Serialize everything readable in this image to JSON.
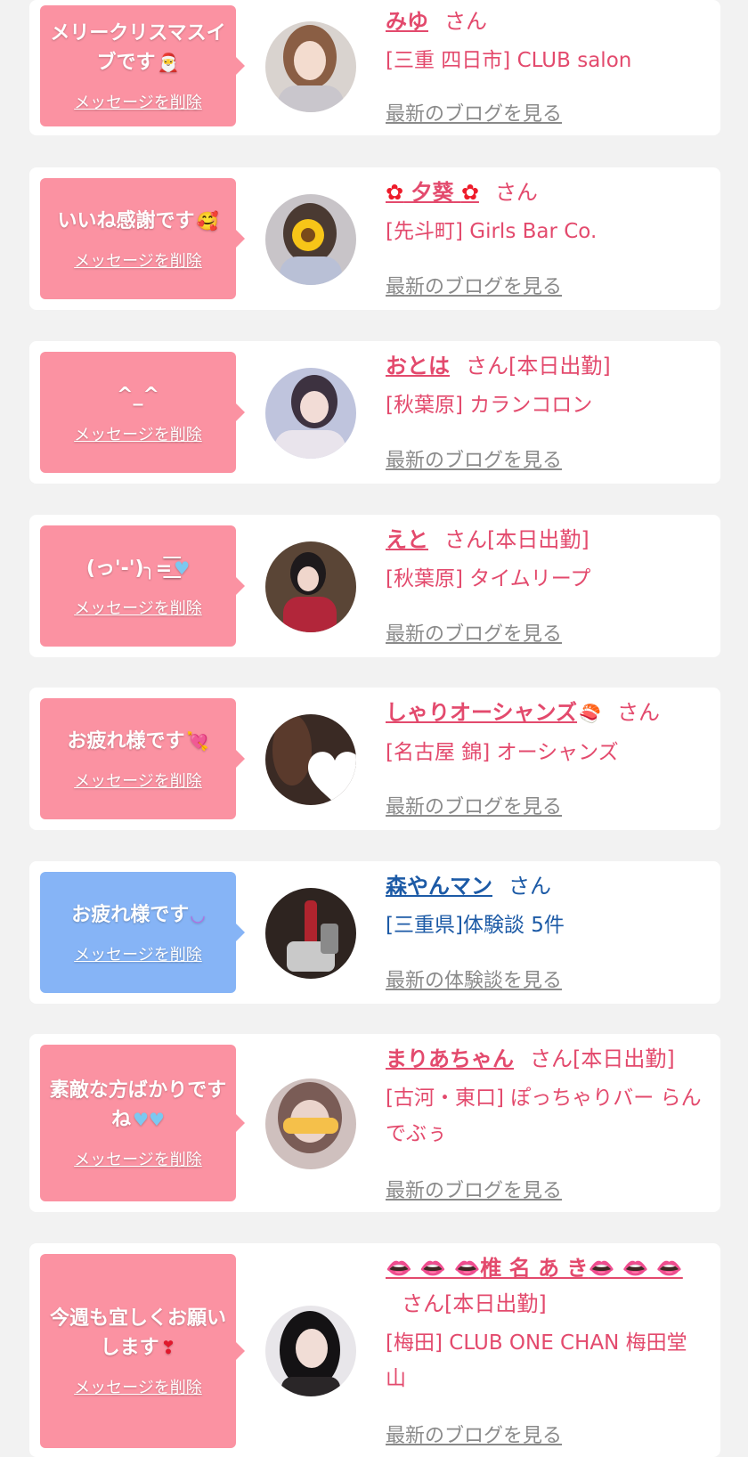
{
  "common": {
    "delete_label": "メッセージを削除",
    "blog_label": "最新のブログを見る",
    "review_label": "最新の体験談を見る"
  },
  "items": [
    {
      "message": "メリークリスマスイブです",
      "message_emoji": "santa-emoji",
      "name": "みゆ",
      "suffix": "さん",
      "shop": "[三重 四日市] CLUB salon",
      "link": "最新のブログを見る"
    },
    {
      "message": "いいね感謝です",
      "message_emoji": "smiling-face-with-hearts-emoji",
      "name": "夕葵",
      "name_decoration": "flower",
      "suffix": "さん",
      "shop": "[先斗町] Girls Bar Co.",
      "link": "最新のブログを見る"
    },
    {
      "message": "^_^",
      "name": "おとは",
      "suffix": "さん[本日出勤]",
      "shop": "[秋葉原] カランコロン",
      "link": "最新のブログを見る"
    },
    {
      "message": "(っ'-')╮=͟͟͞͞",
      "message_emoji": "blue-heart-emoji",
      "name": "えと",
      "suffix": "さん[本日出勤]",
      "shop": "[秋葉原] タイムリープ",
      "link": "最新のブログを見る"
    },
    {
      "message": "お疲れ様です",
      "message_emoji": "heart-with-arrow-emoji",
      "name": "しゃりオーシャンズ",
      "name_emoji": "sushi-emoji",
      "suffix": "さん",
      "shop": "[名古屋 錦] オーシャンズ",
      "link": "最新のブログを見る"
    },
    {
      "message": "お疲れ様です",
      "message_emoji": "smiling-face-emoji",
      "name": "森やんマン",
      "suffix": "さん",
      "shop": "[三重県]体験談 5件",
      "link": "最新の体験談を見る",
      "accent": "#86b4f6"
    },
    {
      "message": "素敵な方ばかりですね",
      "message_emoji": "blue-heart-emoji",
      "name": "まりあちゃん",
      "suffix": "さん[本日出勤]",
      "shop": "[古河・東口] ぽっちゃりバー らんでぶぅ",
      "link": "最新のブログを見る"
    },
    {
      "message": "今週も宜しくお願いします",
      "message_emoji": "heart-emoji",
      "name": "椎 名 あ き",
      "name_decoration": "lips",
      "suffix": "さん[本日出勤]",
      "shop": "[梅田] CLUB ONE CHAN 梅田堂山",
      "link": "最新のブログを見る"
    }
  ],
  "colors": {
    "background": "#f2f2f2",
    "card": "#ffffff",
    "bubble_pink": "#fb92a2",
    "bubble_blue": "#86b4f6",
    "name_pink": "#e34a6d",
    "name_blue": "#1c5aa6",
    "link_gray": "#8a8a8a"
  }
}
